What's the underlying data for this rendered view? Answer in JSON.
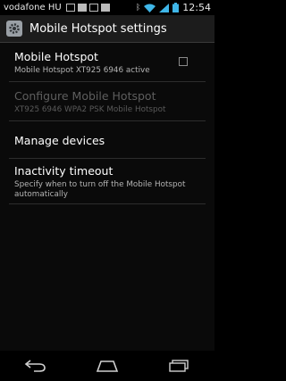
{
  "status_bar": {
    "carrier": "vodafone HU",
    "time": "12:54",
    "icons": [
      "image-icon",
      "mail-icon",
      "image-icon",
      "sd-card-icon",
      "bluetooth-icon",
      "wifi-icon",
      "signal-icon",
      "battery-icon"
    ]
  },
  "action_bar": {
    "title": "Mobile Hotspot settings",
    "icon": "gear-icon"
  },
  "preferences": [
    {
      "title": "Mobile Hotspot",
      "summary": "Mobile Hotspot XT925 6946 active",
      "has_checkbox": true,
      "checked": false,
      "enabled": true
    },
    {
      "title": "Configure Mobile Hotspot",
      "summary": "XT925 6946 WPA2 PSK Mobile Hotspot",
      "enabled": false
    },
    {
      "title": "Manage devices",
      "summary": "",
      "enabled": true
    },
    {
      "title": "Inactivity timeout",
      "summary": "Specify when to turn off the Mobile Hotspot automatically",
      "enabled": true
    }
  ],
  "nav_bar": {
    "buttons": [
      "back-icon",
      "home-icon",
      "recent-apps-icon"
    ]
  }
}
